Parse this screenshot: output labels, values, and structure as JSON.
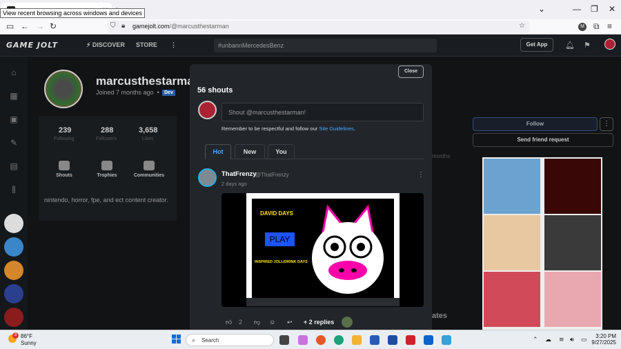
{
  "browser": {
    "tooltip": "View recent browsing across windows and devices",
    "tab_close": "×",
    "new_tab": "+",
    "url_host": "gamejolt.com",
    "url_path": "/@marcusthestarman"
  },
  "header": {
    "logo": "GAME JOLT",
    "discover": "DISCOVER",
    "store": "STORE",
    "search_value": "#unbannMercedesBenz",
    "get_app": "Get App"
  },
  "profile": {
    "username": "marcusthestarman",
    "joined": "Joined 7 months ago",
    "badge": "Dev",
    "stats": [
      {
        "value": "239",
        "label": "Following"
      },
      {
        "value": "288",
        "label": "Followers"
      },
      {
        "value": "3,658",
        "label": "Likes"
      }
    ],
    "links": [
      "Shouts",
      "Trophies",
      "Communities"
    ],
    "bio": "nintendo, horror, fpe, and ect content creator.",
    "follow": "Follow",
    "friend_request": "Send friend request",
    "months_fragment": "months",
    "ates_fragment": "ates"
  },
  "modal": {
    "close": "Close",
    "title": "56 shouts",
    "shout_placeholder": "Shout @marcusthestarman!",
    "rules_prefix": "Remember to be respectful and follow our ",
    "rules_link": "Site Guidelines",
    "rules_suffix": ".",
    "tabs": [
      "Hot",
      "New",
      "You"
    ],
    "post": {
      "author": "ThatFrenzy",
      "handle": "@ThatFrenzy",
      "time": "2 days ago",
      "game_title": "DAVID DAYS",
      "game_play": "PLAY",
      "game_sub": "INSPIRED JOLLIDRINK DAYS",
      "likes": "2",
      "replies": "+ 2 replies"
    }
  },
  "taskbar": {
    "weather_badge": "3",
    "temp": "86°F",
    "condition": "Sunny",
    "search": "Search",
    "time": "3:20 PM",
    "date": "9/27/2025"
  },
  "colors": {
    "accent_blue": "#4ba6ff",
    "dev_badge": "#2a5ca8",
    "page_bg": "#191d21",
    "modal_bg": "#22262b"
  }
}
